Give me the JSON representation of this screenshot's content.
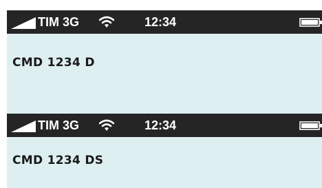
{
  "screens": [
    {
      "status_bar": {
        "carrier": "TIM 3G",
        "time": "12:34",
        "icons": [
          "signal-icon",
          "wifi-icon",
          "battery-icon"
        ]
      },
      "message": "CMD 1234 D"
    },
    {
      "status_bar": {
        "carrier": "TIM 3G",
        "time": "12:34",
        "icons": [
          "signal-icon",
          "wifi-icon",
          "battery-icon"
        ]
      },
      "message": "CMD 1234 DS"
    }
  ],
  "colors": {
    "status_bar_bg": "#252525",
    "screen_bg": "#deeff1",
    "text": "#1a1a1a"
  }
}
